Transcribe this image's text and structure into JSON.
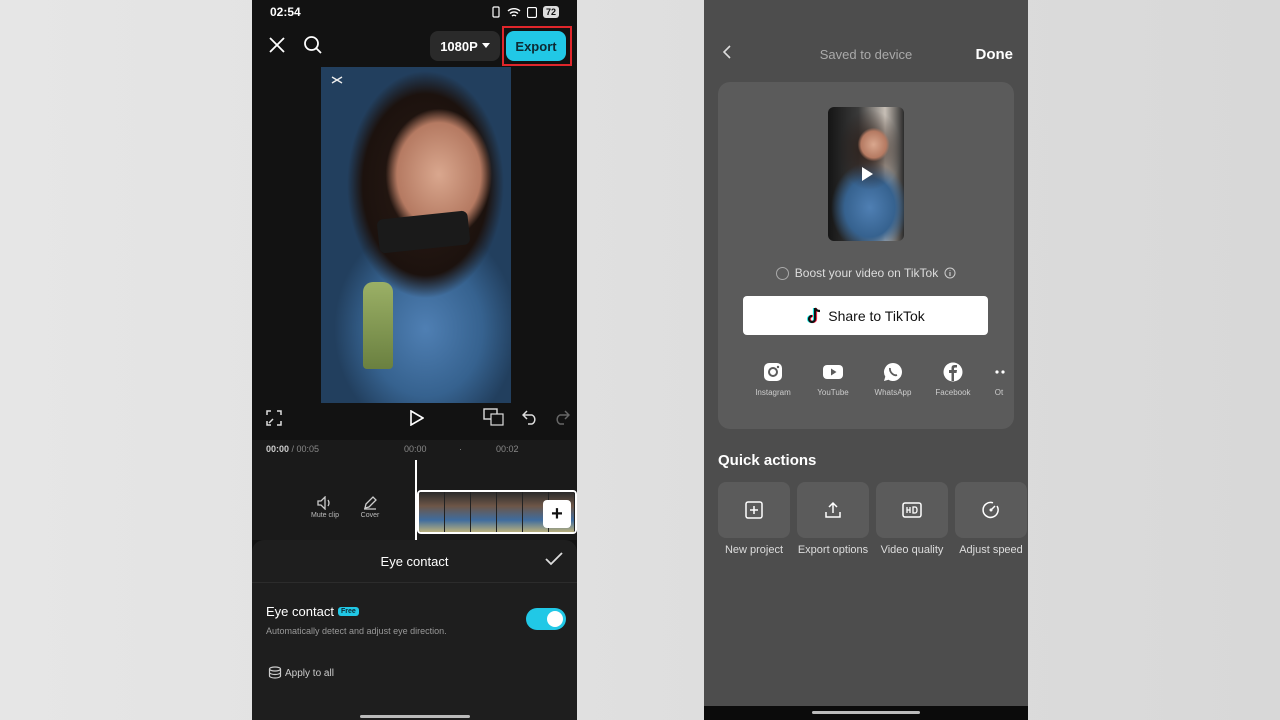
{
  "left": {
    "status": {
      "time": "02:54",
      "battery": "72"
    },
    "topbar": {
      "resolution": "1080P",
      "export_label": "Export"
    },
    "timeline": {
      "current_time": "00:00",
      "total_time": " / 00:05",
      "ticks": [
        "00:00",
        "·",
        "00:02"
      ],
      "mute_label": "Mute clip",
      "cover_label": "Cover",
      "add_label": "+"
    },
    "sheet": {
      "title": "Eye contact",
      "feature_label": "Eye contact",
      "free_badge": "Free",
      "description": "Automatically detect and adjust eye direction.",
      "toggle_on": true,
      "apply_all": "Apply to all"
    }
  },
  "right": {
    "header": {
      "title": "Saved to device",
      "done_label": "Done"
    },
    "boost_label": "Boost your video on TikTok",
    "share_label": "Share to TikTok",
    "socials": [
      {
        "label": "Instagram",
        "icon": "instagram-icon"
      },
      {
        "label": "YouTube",
        "icon": "youtube-icon"
      },
      {
        "label": "WhatsApp",
        "icon": "whatsapp-icon"
      },
      {
        "label": "Facebook",
        "icon": "facebook-icon"
      },
      {
        "label": "Ot",
        "icon": "more-icon"
      }
    ],
    "quick_actions_title": "Quick actions",
    "quick_actions": [
      {
        "label": "New project",
        "icon": "new-project-icon"
      },
      {
        "label": "Export options",
        "icon": "export-options-icon"
      },
      {
        "label": "Video quality",
        "icon": "hd-icon"
      },
      {
        "label": "Adjust speed",
        "icon": "speed-icon"
      }
    ]
  },
  "colors": {
    "accent": "#21c8e6",
    "highlight": "#e0262b"
  }
}
